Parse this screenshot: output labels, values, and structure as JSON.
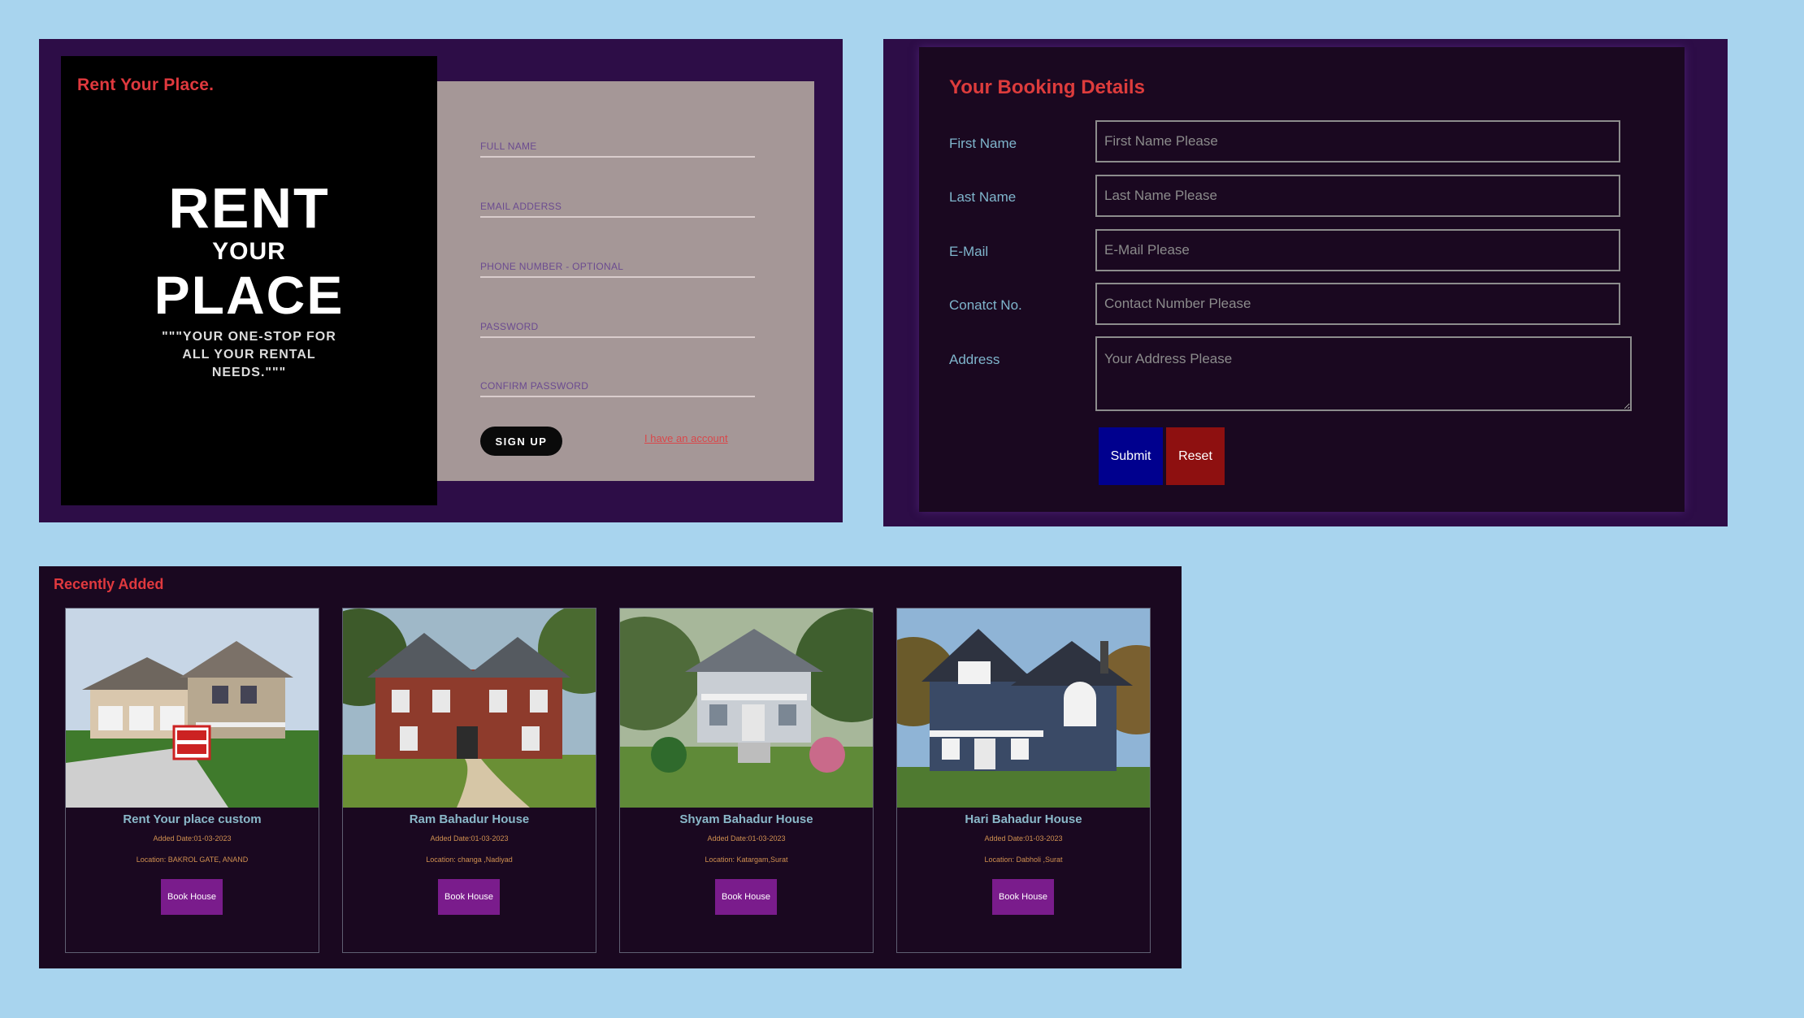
{
  "signup": {
    "brand": "Rent Your Place.",
    "poster_line1": "RENT",
    "poster_line2": "YOUR",
    "poster_line3": "PLACE",
    "tagline": "\"\"\"YOUR ONE-STOP FOR ALL YOUR RENTAL NEEDS.\"\"\"",
    "fields": {
      "full_name": "FULL NAME",
      "email": "EMAIL ADDERSS",
      "phone": "PHONE NUMBER - OPTIONAL",
      "password": "PASSWORD",
      "confirm_password": "CONFIRM PASSWORD"
    },
    "signup_button": "SIGN UP",
    "have_account_link": "I have an account"
  },
  "booking": {
    "title": "Your Booking Details",
    "labels": {
      "first_name": "First Name",
      "last_name": "Last Name",
      "email": "E-Mail",
      "contact": "Conatct No.",
      "address": "Address"
    },
    "placeholders": {
      "first_name": "First Name Please",
      "last_name": "Last Name Please",
      "email": "E-Mail Please",
      "contact": "Contact Number Please",
      "address": "Your Address Please"
    },
    "submit_button": "Submit",
    "reset_button": "Reset"
  },
  "recent": {
    "title": "Recently Added",
    "cards": [
      {
        "title": "Rent Your place custom",
        "added": "Added Date:01-03-2023",
        "location": "Location: BAKROL GATE, ANAND",
        "button": "Book House"
      },
      {
        "title": "Ram Bahadur House",
        "added": "Added Date:01-03-2023",
        "location": "Location: changa ,Nadiyad",
        "button": "Book House"
      },
      {
        "title": "Shyam Bahadur House",
        "added": "Added Date:01-03-2023",
        "location": "Location: Katargam,Surat",
        "button": "Book House"
      },
      {
        "title": "Hari Bahadur House",
        "added": "Added Date:01-03-2023",
        "location": "Location: Dabholi ,Surat",
        "button": "Book House"
      }
    ]
  },
  "colors": {
    "page_bg": "#a8d4ee",
    "panel_bg": "#2d0d47",
    "accent_red": "#e0393e",
    "submit_blue": "#00008e",
    "reset_red": "#8e1010",
    "book_purple": "#7a1c8c"
  }
}
